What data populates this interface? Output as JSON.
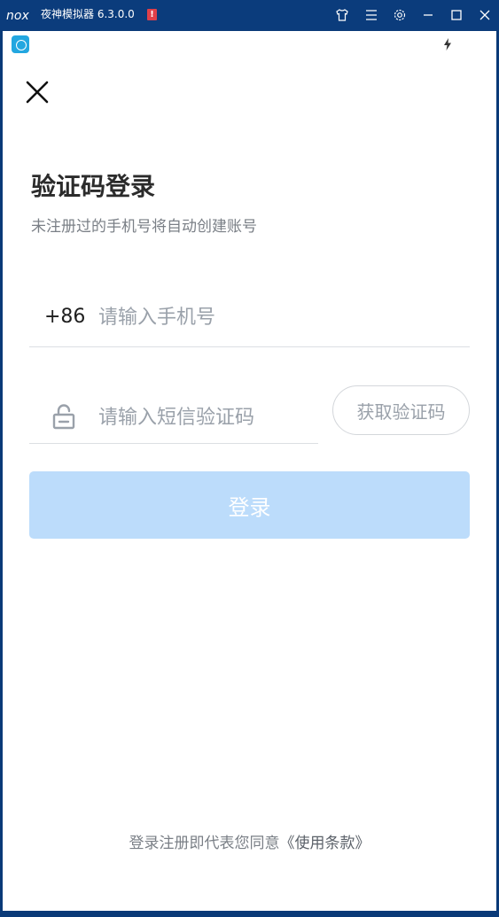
{
  "window": {
    "title": "夜神模拟器 6.3.0.0",
    "warning_badge": "!",
    "icons": [
      "nox-logo-icon",
      "warning-icon",
      "skin-icon",
      "menu-icon",
      "settings-icon",
      "minimize-icon",
      "maximize-icon",
      "close-icon"
    ]
  },
  "status_bar": {
    "app_icon": "app-notification-icon",
    "right_icon": "battery-charging-icon"
  },
  "login": {
    "close_icon": "close-icon",
    "title": "验证码登录",
    "subtitle": "未注册过的手机号将自动创建账号",
    "country_code": "+86",
    "phone_placeholder": "请输入手机号",
    "phone_value": "",
    "code_placeholder": "请输入短信验证码",
    "code_value": "",
    "get_code_label": "获取验证码",
    "submit_label": "登录",
    "terms_prefix": "登录注册即代表您同意",
    "terms_link": "《使用条款》"
  },
  "colors": {
    "titlebar": "#0b3c7c",
    "button_disabled": "#bcdcfb",
    "placeholder": "#9aa1aa",
    "divider": "#dcdfe3"
  }
}
